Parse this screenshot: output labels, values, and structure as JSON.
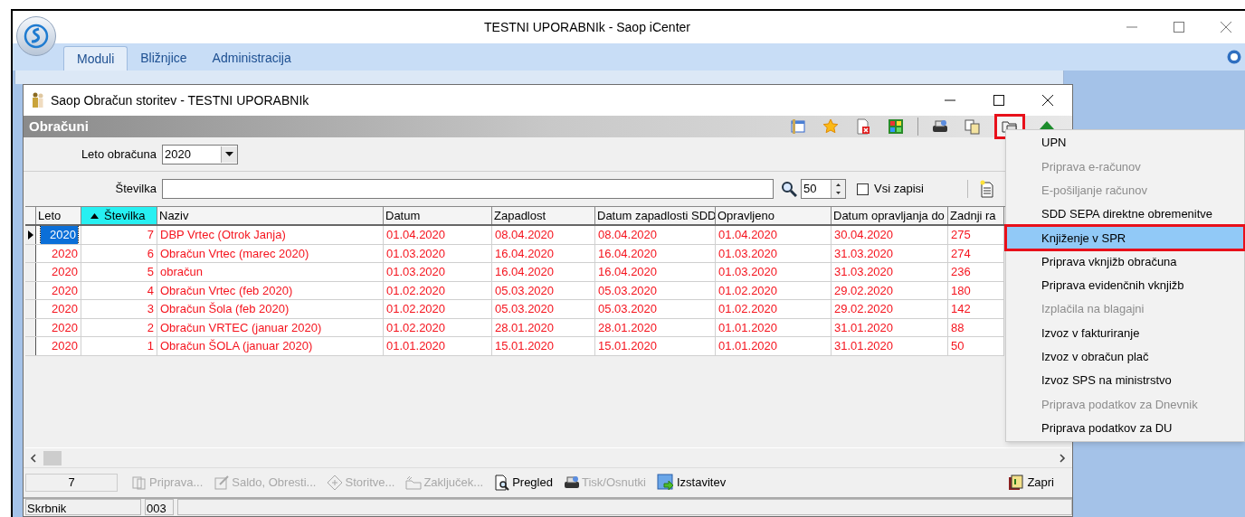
{
  "app": {
    "title": "TESTNI UPORABNIk - Saop iCenter",
    "tabs": [
      {
        "label": "Moduli",
        "selected": true
      },
      {
        "label": "Bližnjice",
        "selected": false
      },
      {
        "label": "Administracija",
        "selected": false
      }
    ]
  },
  "window": {
    "title": "Saop Obračun storitev - TESTNI UPORABNIk",
    "header": "Obračuni",
    "toolbar": [
      {
        "kind": "columns",
        "highlighted": false
      },
      {
        "kind": "star",
        "highlighted": false
      },
      {
        "kind": "delete",
        "highlighted": false
      },
      {
        "kind": "grid",
        "highlighted": false
      },
      {
        "kind": "print",
        "highlighted": false
      },
      {
        "kind": "copy",
        "highlighted": false
      },
      {
        "kind": "folders",
        "highlighted": true
      },
      {
        "kind": "export",
        "highlighted": false
      }
    ],
    "filters": {
      "year_label": "Leto obračuna",
      "year_value": "2020",
      "number_label": "Številka",
      "page_size": "50",
      "all_records": {
        "label": "Vsi zapisi",
        "checked": false
      }
    }
  },
  "table": {
    "columns": [
      {
        "label": "Leto",
        "sorted": false,
        "kind": "number"
      },
      {
        "label": "Številka",
        "sorted": true,
        "kind": "number"
      },
      {
        "label": "Naziv",
        "sorted": false,
        "kind": "text"
      },
      {
        "label": "Datum",
        "sorted": false,
        "kind": "text"
      },
      {
        "label": "Zapadlost",
        "sorted": false,
        "kind": "text"
      },
      {
        "label": "Datum zapadlosti SDD",
        "sorted": false,
        "kind": "text"
      },
      {
        "label": "Opravljeno",
        "sorted": false,
        "kind": "text"
      },
      {
        "label": "Datum opravljanja do",
        "sorted": false,
        "kind": "text"
      },
      {
        "label": "Zadnji ra",
        "sorted": false,
        "kind": "text"
      }
    ],
    "rows": [
      {
        "selected": true,
        "cells": [
          "2020",
          "7",
          "DBP Vrtec (Otrok Janja)",
          "01.04.2020",
          "08.04.2020",
          "08.04.2020",
          "01.04.2020",
          "30.04.2020",
          "275"
        ]
      },
      {
        "selected": false,
        "cells": [
          "2020",
          "6",
          "Obračun Vrtec (marec 2020)",
          "01.03.2020",
          "16.04.2020",
          "16.04.2020",
          "01.03.2020",
          "31.03.2020",
          "274"
        ]
      },
      {
        "selected": false,
        "cells": [
          "2020",
          "5",
          "obračun",
          "01.03.2020",
          "16.04.2020",
          "16.04.2020",
          "01.03.2020",
          "31.03.2020",
          "236"
        ]
      },
      {
        "selected": false,
        "cells": [
          "2020",
          "4",
          "Obračun Vrtec (feb 2020)",
          "01.02.2020",
          "05.03.2020",
          "05.03.2020",
          "01.02.2020",
          "29.02.2020",
          "180"
        ]
      },
      {
        "selected": false,
        "cells": [
          "2020",
          "3",
          "Obračun Šola (feb 2020)",
          "01.02.2020",
          "05.03.2020",
          "05.03.2020",
          "01.02.2020",
          "29.02.2020",
          "142"
        ]
      },
      {
        "selected": false,
        "cells": [
          "2020",
          "2",
          "Obračun VRTEC (januar 2020)",
          "01.02.2020",
          "28.01.2020",
          "28.01.2020",
          "01.01.2020",
          "31.01.2020",
          "88"
        ]
      },
      {
        "selected": false,
        "cells": [
          "2020",
          "1",
          "Obračun ŠOLA (januar 2020)",
          "01.01.2020",
          "15.01.2020",
          "15.01.2020",
          "01.01.2020",
          "31.01.2020",
          "50"
        ]
      }
    ]
  },
  "bottom_bar": {
    "count": "7",
    "buttons": [
      {
        "kind": "prepare",
        "label": "Priprava...",
        "disabled": true
      },
      {
        "kind": "balance",
        "label": "Saldo, Obresti...",
        "disabled": true
      },
      {
        "kind": "services",
        "label": "Storitve...",
        "disabled": true
      },
      {
        "kind": "close-period",
        "label": "Zaključek...",
        "disabled": true
      },
      {
        "kind": "preview",
        "label": "Pregled",
        "disabled": false
      },
      {
        "kind": "print",
        "label": "Tisk/Osnutki",
        "disabled": true
      },
      {
        "kind": "issue",
        "label": "Izstavitev",
        "disabled": false
      }
    ],
    "close": "Zapri"
  },
  "status_bar": [
    "Skrbnik",
    "003"
  ],
  "menu": [
    {
      "label": "UPN",
      "disabled": false,
      "selected": false
    },
    {
      "label": "Priprava e-računov",
      "disabled": true,
      "selected": false
    },
    {
      "label": "E-pošiljanje računov",
      "disabled": true,
      "selected": false
    },
    {
      "label": "SDD SEPA direktne obremenitve",
      "disabled": false,
      "selected": false
    },
    {
      "label": "Knjiženje v SPR",
      "disabled": false,
      "selected": true
    },
    {
      "label": "Priprava vknjižb obračuna",
      "disabled": false,
      "selected": false
    },
    {
      "label": "Priprava evidenčnih vknjižb",
      "disabled": false,
      "selected": false
    },
    {
      "label": "Izplačila na blagajni",
      "disabled": true,
      "selected": false
    },
    {
      "label": "Izvoz v fakturiranje",
      "disabled": false,
      "selected": false
    },
    {
      "label": "Izvoz v obračun plač",
      "disabled": false,
      "selected": false
    },
    {
      "label": "Izvoz SPS na ministrstvo",
      "disabled": false,
      "selected": false
    },
    {
      "label": "Priprava podatkov za Dnevnik",
      "disabled": true,
      "selected": false
    },
    {
      "label": "Priprava podatkov za DU",
      "disabled": false,
      "selected": false
    }
  ]
}
